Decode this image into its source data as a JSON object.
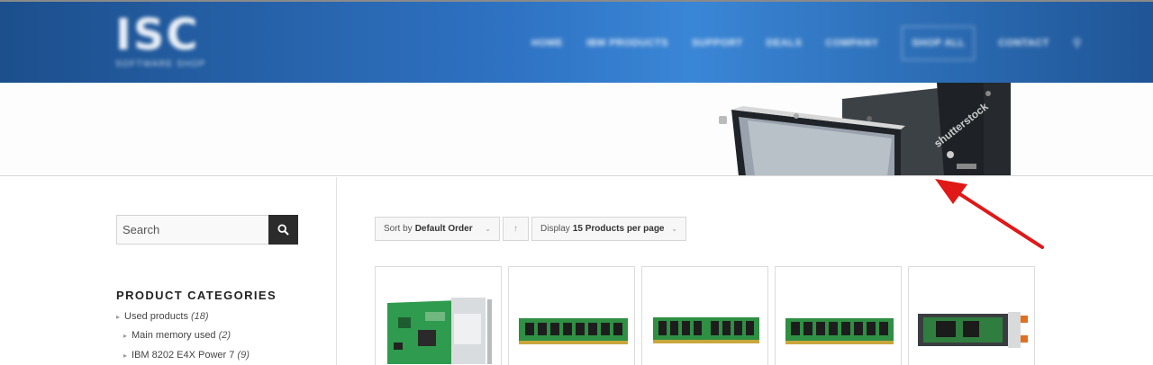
{
  "header": {
    "logo_text": "ISC",
    "logo_subtext": "SOFTWARE SHOP",
    "nav": [
      "HOME",
      "IBM PRODUCTS",
      "SUPPORT",
      "DEALS",
      "COMPANY",
      "SHOP ALL",
      "CONTACT"
    ]
  },
  "banner": {
    "watermark": "shutterstock"
  },
  "sidebar": {
    "search_placeholder": "Search",
    "categories_title": "PRODUCT CATEGORIES",
    "categories": [
      {
        "label": "Used products",
        "count": "(18)"
      },
      {
        "label": "Main memory used",
        "count": "(2)"
      },
      {
        "label": "IBM 8202 E4X Power 7",
        "count": "(9)"
      }
    ]
  },
  "toolbar": {
    "sort_prefix": "Sort by",
    "sort_value": "Default Order",
    "display_prefix": "Display",
    "display_value": "15 Products per page"
  },
  "products": [
    {
      "image": "pci-card"
    },
    {
      "image": "memory-module"
    },
    {
      "image": "memory-module"
    },
    {
      "image": "memory-module"
    },
    {
      "image": "flash-adapter"
    }
  ],
  "colors": {
    "header_blue": "#2f73c4",
    "annotation_red": "#e01818",
    "search_button": "#2b2b2b"
  }
}
